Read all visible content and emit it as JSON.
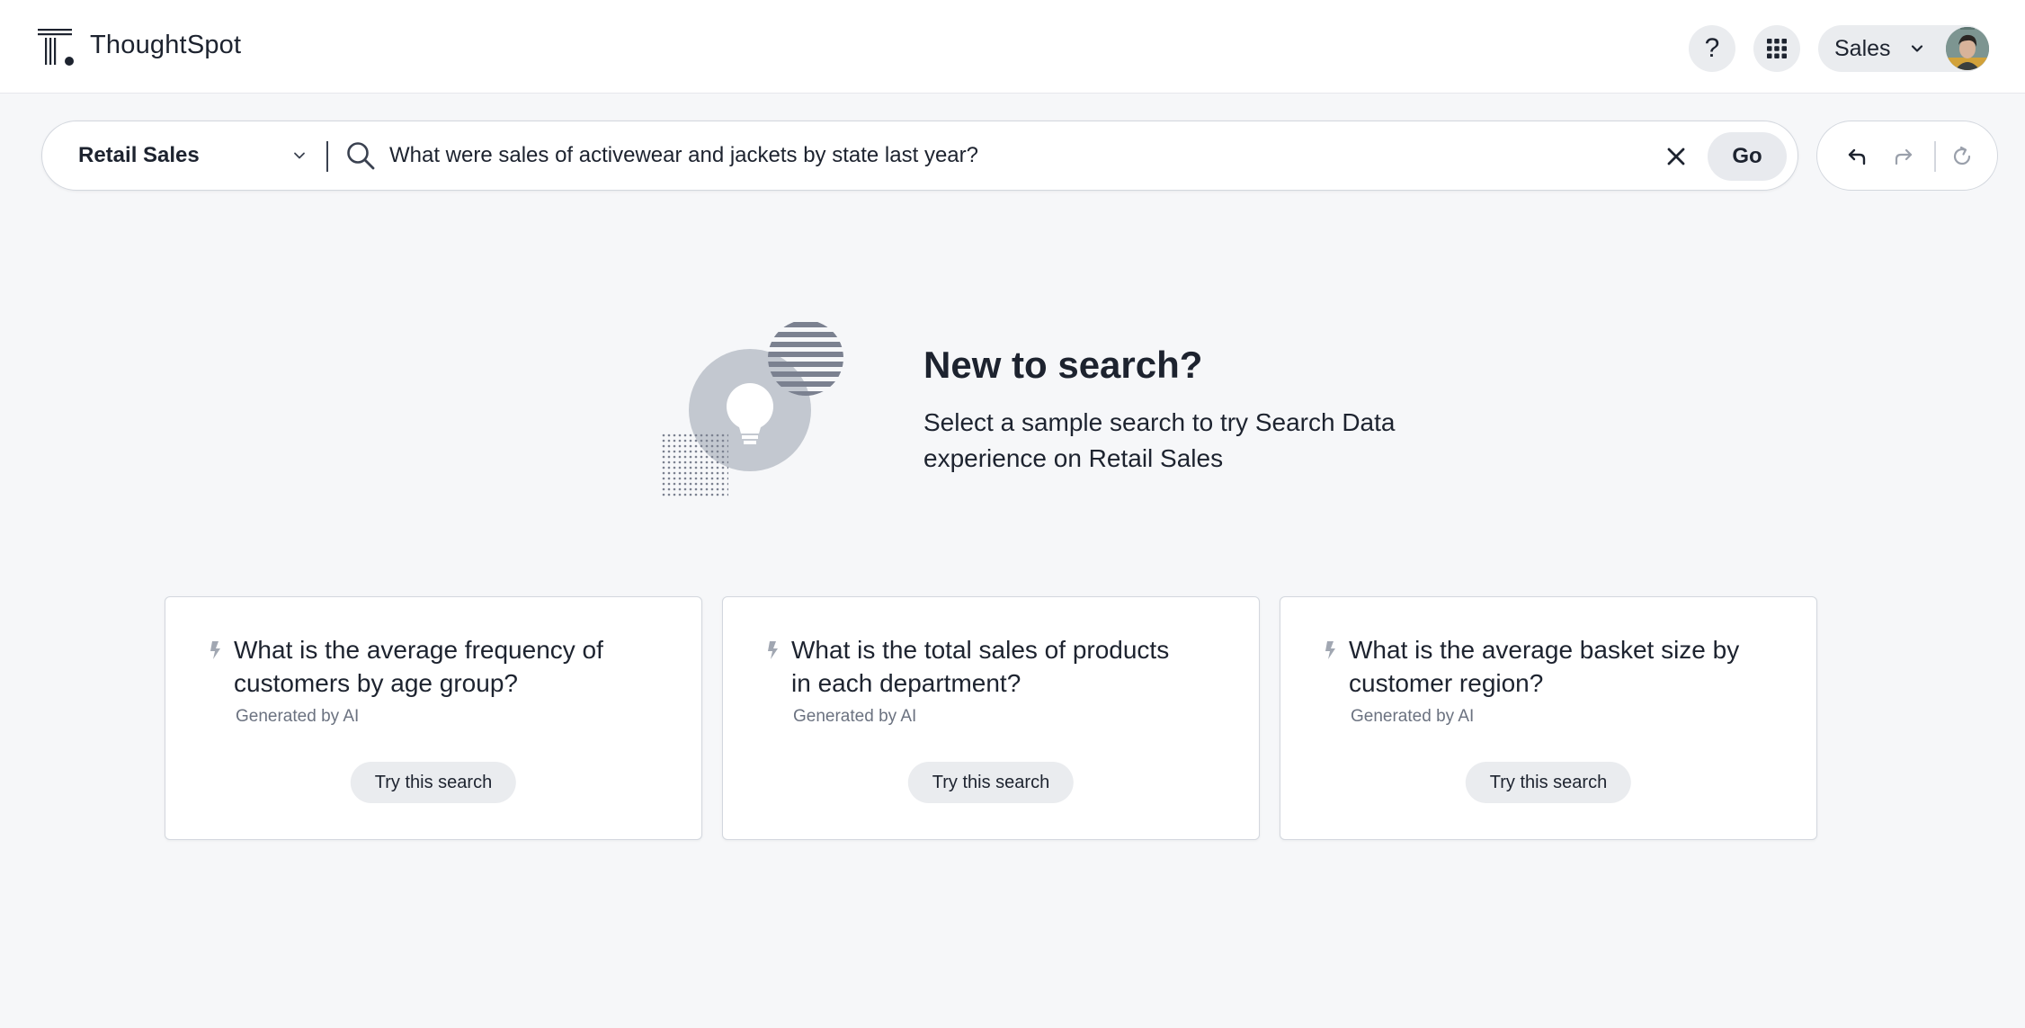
{
  "header": {
    "brand": "ThoughtSpot",
    "help_symbol": "?",
    "org_label": "Sales",
    "icons": [
      "thoughtspot-logo-icon",
      "help-icon",
      "apps-grid-icon",
      "chevron-down-icon",
      "user-avatar"
    ]
  },
  "search": {
    "data_source": "Retail Sales",
    "query": "What were sales of activewear and jackets by state last year?",
    "go_label": "Go",
    "icons": [
      "chevron-down-icon",
      "search-icon",
      "close-icon",
      "undo-icon",
      "redo-icon",
      "reset-icon"
    ]
  },
  "hero": {
    "title": "New to search?",
    "subtitle": "Select a sample search to try Search Data experience on Retail Sales",
    "illustration": "lightbulb-illustration"
  },
  "cards": [
    {
      "question": "What is the average frequency of customers by age group?",
      "meta": "Generated by AI",
      "button": "Try this search"
    },
    {
      "question": "What is the total sales of products in each department?",
      "meta": "Generated by AI",
      "button": "Try this search"
    },
    {
      "question": "What is the average basket size by customer region?",
      "meta": "Generated by AI",
      "button": "Try this search"
    }
  ],
  "colors": {
    "background": "#f6f7f9",
    "surface": "#ffffff",
    "text": "#1d232f",
    "muted": "#6b7280",
    "pill": "#eaecef",
    "illustration": "#c3c8d0"
  }
}
